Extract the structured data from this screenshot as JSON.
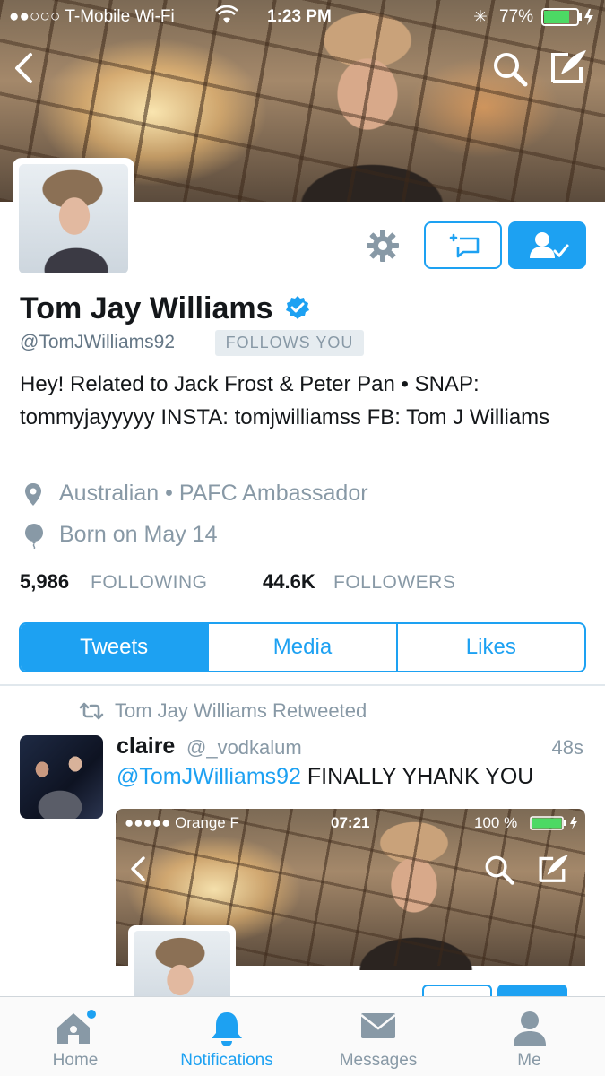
{
  "status_bar": {
    "carrier": "●●○○○ T-Mobile Wi-Fi",
    "time": "1:23 PM",
    "battery": "77%"
  },
  "profile": {
    "name": "Tom Jay Williams",
    "handle": "@TomJWilliams92",
    "follows_badge": "FOLLOWS YOU",
    "bio": "Hey! Related to Jack Frost & Peter Pan • SNAP: tommyjayyyyy INSTA: tomjwilliamss FB: Tom J Williams",
    "location": "Australian • PAFC Ambassador",
    "birthday": "Born on May 14",
    "following_count": "5,986",
    "following_label": "FOLLOWING",
    "followers_count": "44.6K",
    "followers_label": "FOLLOWERS"
  },
  "tabs": [
    {
      "label": "Tweets",
      "active": true
    },
    {
      "label": "Media",
      "active": false
    },
    {
      "label": "Likes",
      "active": false
    }
  ],
  "tweet": {
    "retweet_context": "Tom Jay Williams Retweeted",
    "author_name": "claire",
    "author_handle": "@_vodkalum",
    "time": "48s",
    "mention": "@TomJWilliams92",
    "text": " FINALLY YHANK YOU",
    "media_status": {
      "carrier": "●●●●● Orange F",
      "time": "07:21",
      "battery": "100 %"
    }
  },
  "bottom_nav": [
    {
      "label": "Home",
      "icon": "home-icon",
      "active": false
    },
    {
      "label": "Notifications",
      "icon": "bell-icon",
      "active": true
    },
    {
      "label": "Messages",
      "icon": "envelope-icon",
      "active": false
    },
    {
      "label": "Me",
      "icon": "person-icon",
      "active": false
    }
  ],
  "colors": {
    "accent": "#1da1f2",
    "muted": "#8899a6",
    "text": "#14171a"
  }
}
